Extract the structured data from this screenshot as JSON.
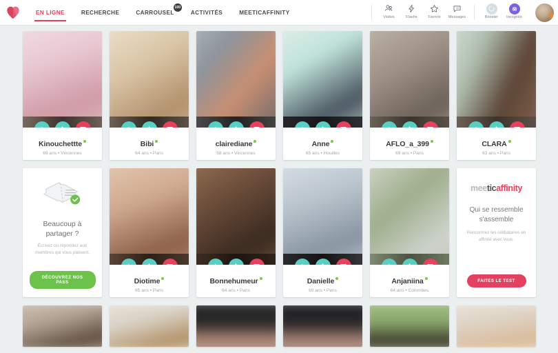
{
  "header": {
    "logo": "heart-logo",
    "nav": [
      {
        "label": "EN LIGNE",
        "active": true,
        "badge": null
      },
      {
        "label": "RECHERCHE",
        "active": false,
        "badge": null
      },
      {
        "label": "CARROUSEL",
        "active": false,
        "badge": "100"
      },
      {
        "label": "ACTIVITÉS",
        "active": false,
        "badge": null
      },
      {
        "label": "MEETICAFFINITY",
        "active": false,
        "badge": null
      }
    ],
    "tools": [
      {
        "label": "Visites",
        "icon": "visites-icon"
      },
      {
        "label": "Flashs",
        "icon": "flash-icon"
      },
      {
        "label": "Favoris",
        "icon": "star-icon"
      },
      {
        "label": "Messages",
        "icon": "message-icon"
      }
    ],
    "boosts": [
      {
        "label": "Booster",
        "icon": "booster-icon"
      },
      {
        "label": "Incognito",
        "icon": "incognito-icon"
      }
    ],
    "avatar": "user-avatar"
  },
  "colors": {
    "accent_pink": "#e4405f",
    "teal": "#59cfc4",
    "message_red": "#e8415e",
    "green": "#6cc24a",
    "online_dot": "#7ac943",
    "page_bg": "#eceff0"
  },
  "actions": {
    "flash": "Flash",
    "favorite": "Favori",
    "message": "Message"
  },
  "rows": {
    "row1": [
      {
        "name": "Kinouchettte",
        "age": "69 ans",
        "city": "Vincennes",
        "meta": "69 ans • Vincennes",
        "online": true,
        "c1": "#e8c8d2",
        "c2": "#cf9aa6",
        "c3": "#f0dfe2"
      },
      {
        "name": "Bibi",
        "age": "64 ans",
        "city": "Paris",
        "meta": "64 ans • Paris",
        "online": true,
        "c1": "#d8c4a5",
        "c2": "#b28f6a",
        "c3": "#efe4d0"
      },
      {
        "name": "clairediane",
        "age": "58 ans",
        "city": "Vincennes",
        "meta": "58 ans • Vincennes",
        "online": true,
        "c1": "#9aa0a8",
        "c2": "#c98f72",
        "c3": "#5c6068"
      },
      {
        "name": "Anne",
        "age": "65 ans",
        "city": "Houilles",
        "meta": "65 ans • Houilles",
        "online": true,
        "c1": "#bfe3da",
        "c2": "#4a5560",
        "c3": "#d6ece6"
      },
      {
        "name": "AFLO_a_399",
        "age": "69 ans",
        "city": "Paris",
        "meta": "69 ans • Paris",
        "online": true,
        "c1": "#9e9186",
        "c2": "#6c6158",
        "c3": "#bdb3a6"
      },
      {
        "name": "CLARA",
        "age": "63 ans",
        "city": "Paris",
        "meta": "63 ans • Paris",
        "online": true,
        "c1": "#cdd8cd",
        "c2": "#5b4436",
        "c3": "#b9c6b6"
      }
    ],
    "row2_promo": {
      "icon": "ticket-icon",
      "title": "Beaucoup à partager ?",
      "subtitle": "Écrivez ou répondez aux membres qui vous plaisent.",
      "button": "DÉCOUVREZ NOS PASS"
    },
    "row2": [
      {
        "name": "Diotime",
        "age": "65 ans",
        "city": "Paris",
        "meta": "65 ans • Paris",
        "online": true,
        "c1": "#cfa98e",
        "c2": "#8c6049",
        "c3": "#e3c7ad"
      },
      {
        "name": "Bonnehumeur",
        "age": "64 ans",
        "city": "Paris",
        "meta": "64 ans • Paris",
        "online": true,
        "c1": "#6b4d3a",
        "c2": "#3a2a20",
        "c3": "#8f6b52"
      },
      {
        "name": "Danielle",
        "age": "69 ans",
        "city": "Paris",
        "meta": "69 ans • Paris",
        "online": true,
        "c1": "#b9c3cc",
        "c2": "#8794a0",
        "c3": "#d7dee5"
      },
      {
        "name": "Anjaniina",
        "age": "64 ans",
        "city": "Colombes",
        "meta": "64 ans • Colombes",
        "online": true,
        "c1": "#9fae8a",
        "c2": "#cfd4cf",
        "c3": "#b4bfa7"
      }
    ],
    "row2_affinity": {
      "logo_part1": "mee",
      "logo_part2": "tic",
      "logo_part3": "affinity",
      "title": "Qui se ressemble s'assemble",
      "subtitle": "Rencontrez les célibataires en affinité avec vous.",
      "button": "FAITES LE TEST"
    },
    "row3": [
      {
        "c1": "#b5a595",
        "c2": "#5e4c3d",
        "c3": "#c9bcac"
      },
      {
        "c1": "#d9d2c6",
        "c2": "#b08e62",
        "c3": "#e6e1d6"
      },
      {
        "c1": "#2a2a2c",
        "c2": "#d9a68e",
        "c3": "#3c3c3e"
      },
      {
        "c1": "#26262a",
        "c2": "#cfa08c",
        "c3": "#3a3a3e"
      },
      {
        "c1": "#8fae70",
        "c2": "#2f2722",
        "c3": "#a8c189"
      },
      {
        "c1": "#ddd3c6",
        "c2": "#d9b895",
        "c3": "#ece4d7"
      }
    ]
  }
}
